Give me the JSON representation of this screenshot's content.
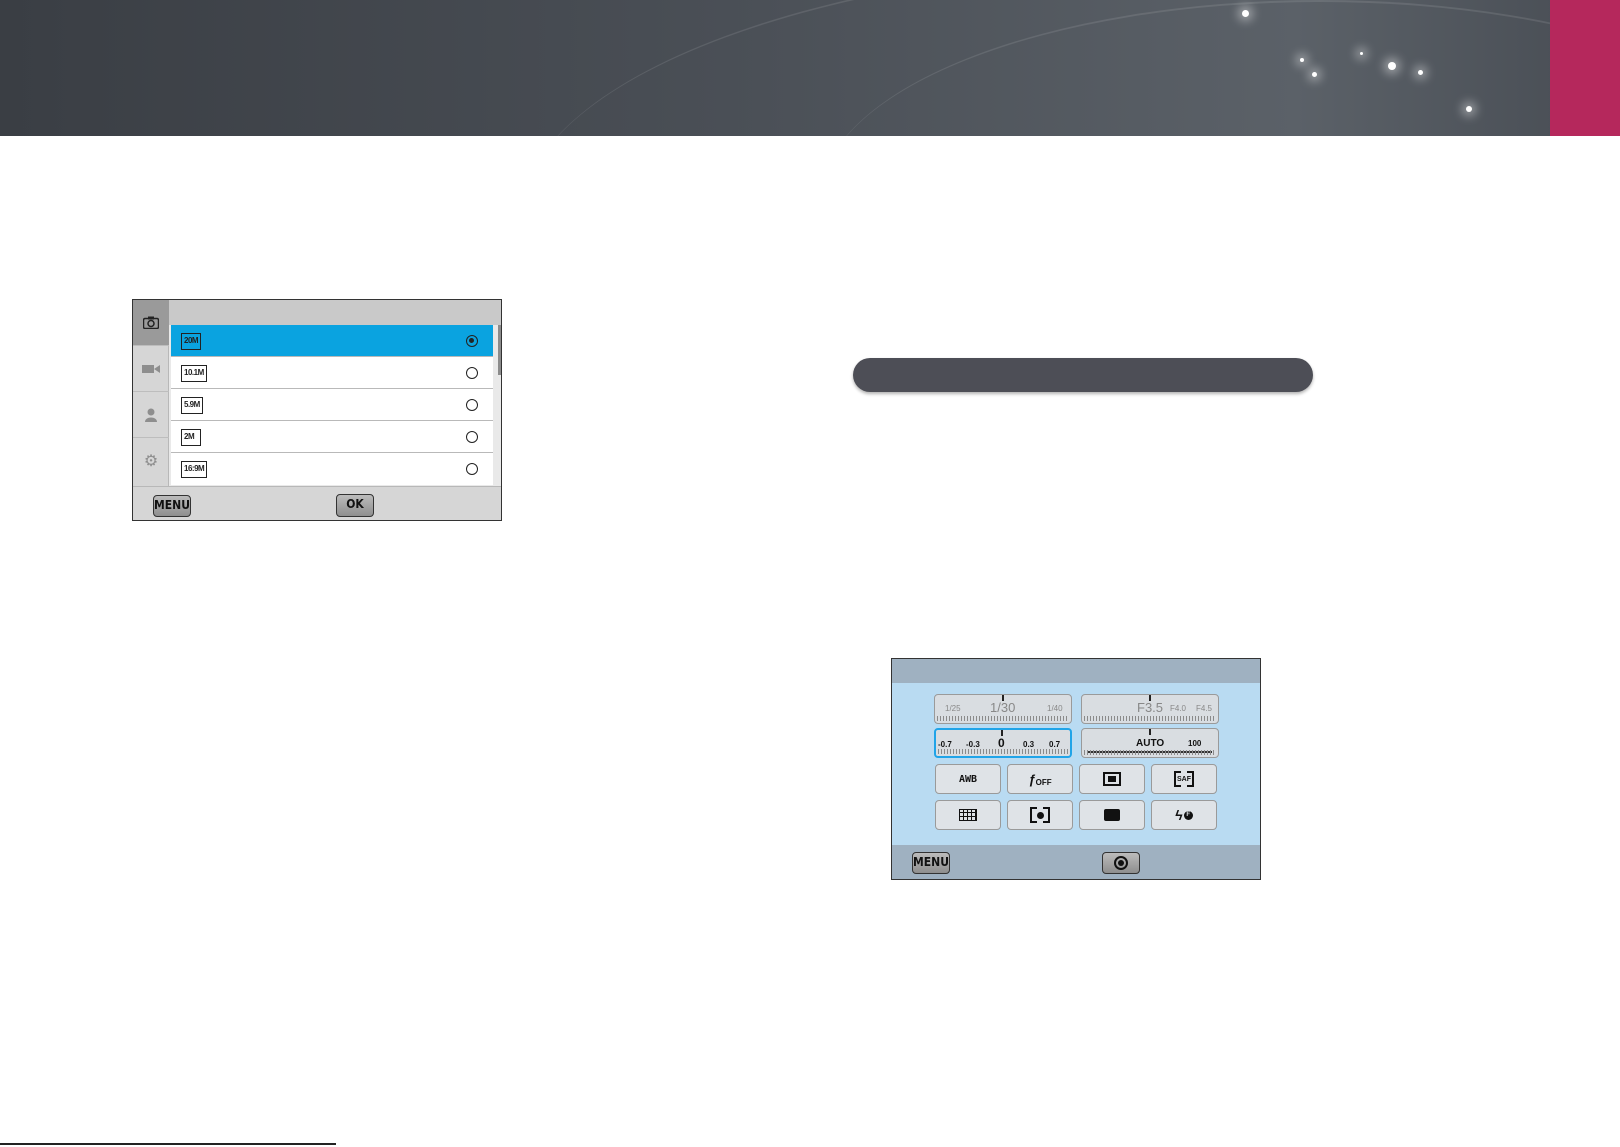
{
  "banner": {
    "accent_color": "#b5285c"
  },
  "photo_size_menu": {
    "categories": [
      {
        "icon": "camera-icon",
        "active": true
      },
      {
        "icon": "video-camera-icon",
        "active": false
      },
      {
        "icon": "person-icon",
        "active": false
      },
      {
        "icon": "gear-icon",
        "active": false
      }
    ],
    "rows": [
      {
        "icon_text": "20M",
        "selected": true
      },
      {
        "icon_text": "10.1M",
        "selected": false
      },
      {
        "icon_text": "5.9M",
        "selected": false
      },
      {
        "icon_text": "2M",
        "selected": false
      },
      {
        "icon_text": "16:9M",
        "selected": false
      }
    ],
    "menu_label": "MENU",
    "ok_label": "OK",
    "selected_color": "#0aa3e0"
  },
  "shooting_panel": {
    "shutter": {
      "left": "1/25",
      "center": "1/30",
      "right": "1/40"
    },
    "aperture": {
      "center": "F3.5",
      "right1": "F4.0",
      "right2": "F4.5"
    },
    "exposure": {
      "values": [
        "-0.7",
        "-0.3",
        "0",
        "0.3",
        "0.7"
      ]
    },
    "iso": {
      "center": "AUTO",
      "right": "100"
    },
    "buttons_row1": [
      {
        "label": "AWB",
        "icon": "white-balance-icon"
      },
      {
        "label": "OFF",
        "icon": "smart-filter-off-icon"
      },
      {
        "label": "",
        "icon": "metering-icon"
      },
      {
        "label": "SAF",
        "icon": "autofocus-icon"
      }
    ],
    "buttons_row2": [
      {
        "label": "",
        "icon": "grid-icon"
      },
      {
        "label": "",
        "icon": "face-detection-icon"
      },
      {
        "label": "",
        "icon": "display-icon"
      },
      {
        "label": "F",
        "icon": "flash-icon"
      }
    ],
    "menu_label": "MENU",
    "focus_color": "#20a4e8"
  }
}
